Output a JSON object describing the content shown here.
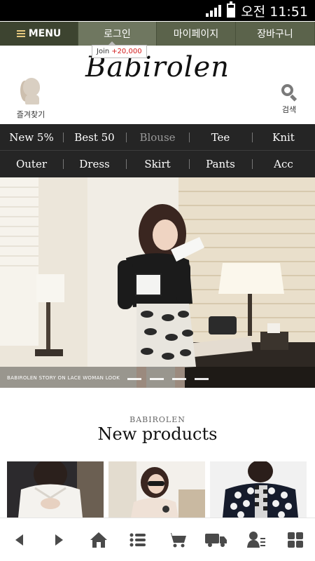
{
  "status_bar": {
    "time": "오전 11:51"
  },
  "top_nav": {
    "menu_label": "MENU",
    "login_label": "로그인",
    "mypage_label": "마이페이지",
    "cart_label": "장바구니"
  },
  "join_tooltip": {
    "label": "Join",
    "amount": "+20,000"
  },
  "header": {
    "logo": "Babirolen",
    "favorites_label": "즐겨찾기",
    "search_label": "검색"
  },
  "categories": {
    "row1": [
      "New 5%",
      "Best 50",
      "Blouse",
      "Tee",
      "Knit"
    ],
    "row2": [
      "Outer",
      "Dress",
      "Skirt",
      "Pants",
      "Acc"
    ]
  },
  "hero": {
    "caption": "BABIROLEN STORY ON LACE WOMAN LOOK"
  },
  "new_products": {
    "subtitle": "BABIROLEN",
    "title": "New products"
  },
  "bottom_nav": {
    "icons": [
      "back-arrow-icon",
      "forward-arrow-icon",
      "home-icon",
      "list-icon",
      "cart-icon",
      "delivery-truck-icon",
      "user-list-icon",
      "grid-icon"
    ]
  },
  "colors": {
    "top_nav": "#5b634b",
    "menu_bg": "#3d4430",
    "menu_text": "#e6c97f",
    "category_bg": "#252525",
    "join_amount": "#d21b1b"
  }
}
